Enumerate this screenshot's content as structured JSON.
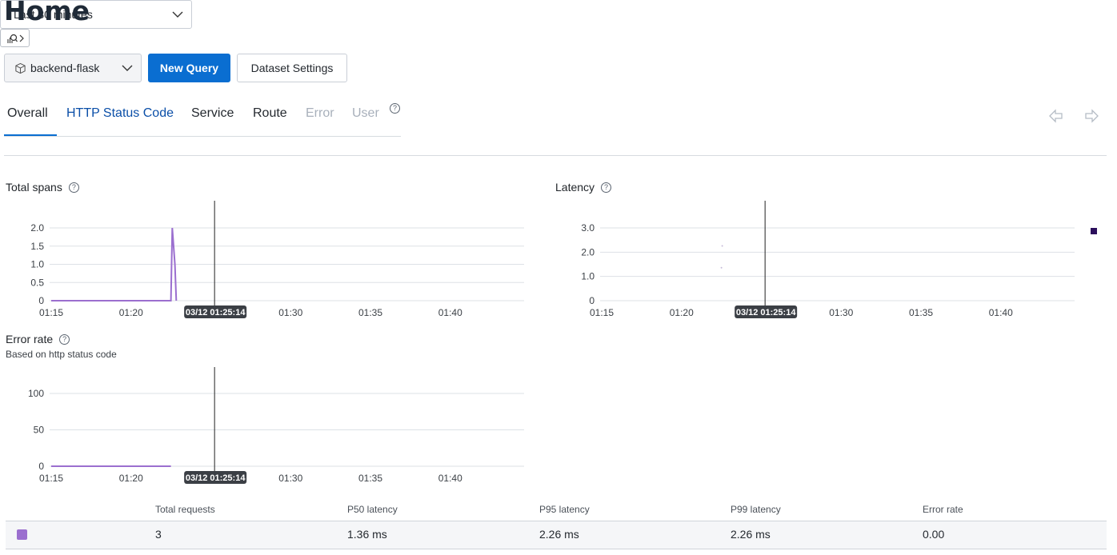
{
  "page": {
    "title": "Home"
  },
  "toolbar": {
    "dataset": "backend-flask",
    "new_query": "New Query",
    "dataset_settings": "Dataset Settings"
  },
  "tabs": [
    {
      "label": "Overall",
      "state": "active"
    },
    {
      "label": "HTTP Status Code",
      "state": "link"
    },
    {
      "label": "Service",
      "state": "normal"
    },
    {
      "label": "Route",
      "state": "normal"
    },
    {
      "label": "Error",
      "state": "disabled"
    },
    {
      "label": "User",
      "state": "disabled"
    }
  ],
  "time_range": {
    "selected": "Last 30 minutes"
  },
  "cursor_label": "03/12 01:25:14",
  "charts": {
    "total_spans": {
      "title": "Total spans"
    },
    "latency": {
      "title": "Latency"
    },
    "error_rate": {
      "title": "Error rate",
      "subtitle": "Based on http status code"
    }
  },
  "chart_data": [
    {
      "type": "area",
      "title": "Total spans",
      "x_ticks": [
        "01:15",
        "01:20",
        "01:30",
        "01:35",
        "01:40"
      ],
      "y_ticks": [
        "0",
        "0.5",
        "1.0",
        "1.5",
        "2.0"
      ],
      "ylim": [
        0,
        2.0
      ],
      "series": [
        {
          "color": "#9b6fcf",
          "x": [
            "01:15",
            "01:22:30",
            "01:22:35",
            "01:22:45",
            "01:22:50",
            "01:25:14"
          ],
          "values": [
            0,
            0,
            2,
            1,
            0,
            null
          ]
        }
      ],
      "cursor": "03/12 01:25:14"
    },
    {
      "type": "scatter",
      "title": "Latency",
      "x_ticks": [
        "01:15",
        "01:20",
        "01:30",
        "01:35",
        "01:40"
      ],
      "y_ticks": [
        "0",
        "1.0",
        "2.0",
        "3.0"
      ],
      "ylim": [
        0,
        3.0
      ],
      "series": [
        {
          "color": "#2b0f5c",
          "x": [
            "01:22:30",
            "01:22:30"
          ],
          "values": [
            2.26,
            1.36
          ]
        }
      ],
      "cursor": "03/12 01:25:14"
    },
    {
      "type": "area",
      "title": "Error rate",
      "x_ticks": [
        "01:15",
        "01:20",
        "01:30",
        "01:35",
        "01:40"
      ],
      "y_ticks": [
        "0",
        "50",
        "100"
      ],
      "ylim": [
        0,
        100
      ],
      "series": [
        {
          "color": "#9b6fcf",
          "x": [
            "01:15",
            "01:22:30"
          ],
          "values": [
            0,
            0
          ]
        }
      ],
      "cursor": "03/12 01:25:14"
    }
  ],
  "table": {
    "headers": [
      "Total requests",
      "P50 latency",
      "P95 latency",
      "P99 latency",
      "Error rate"
    ],
    "rows": [
      {
        "total_requests": "3",
        "p50": "1.36 ms",
        "p95": "2.26 ms",
        "p99": "2.26 ms",
        "error_rate": "0.00",
        "swatch_color": "#9b6fcf"
      }
    ]
  },
  "icons": {
    "dataset": "cube-icon",
    "dropdown": "chevron-down-icon",
    "help": "help-circle-icon",
    "prev": "arrow-left-icon",
    "next": "arrow-right-icon",
    "row_action": "query-builder-icon"
  }
}
